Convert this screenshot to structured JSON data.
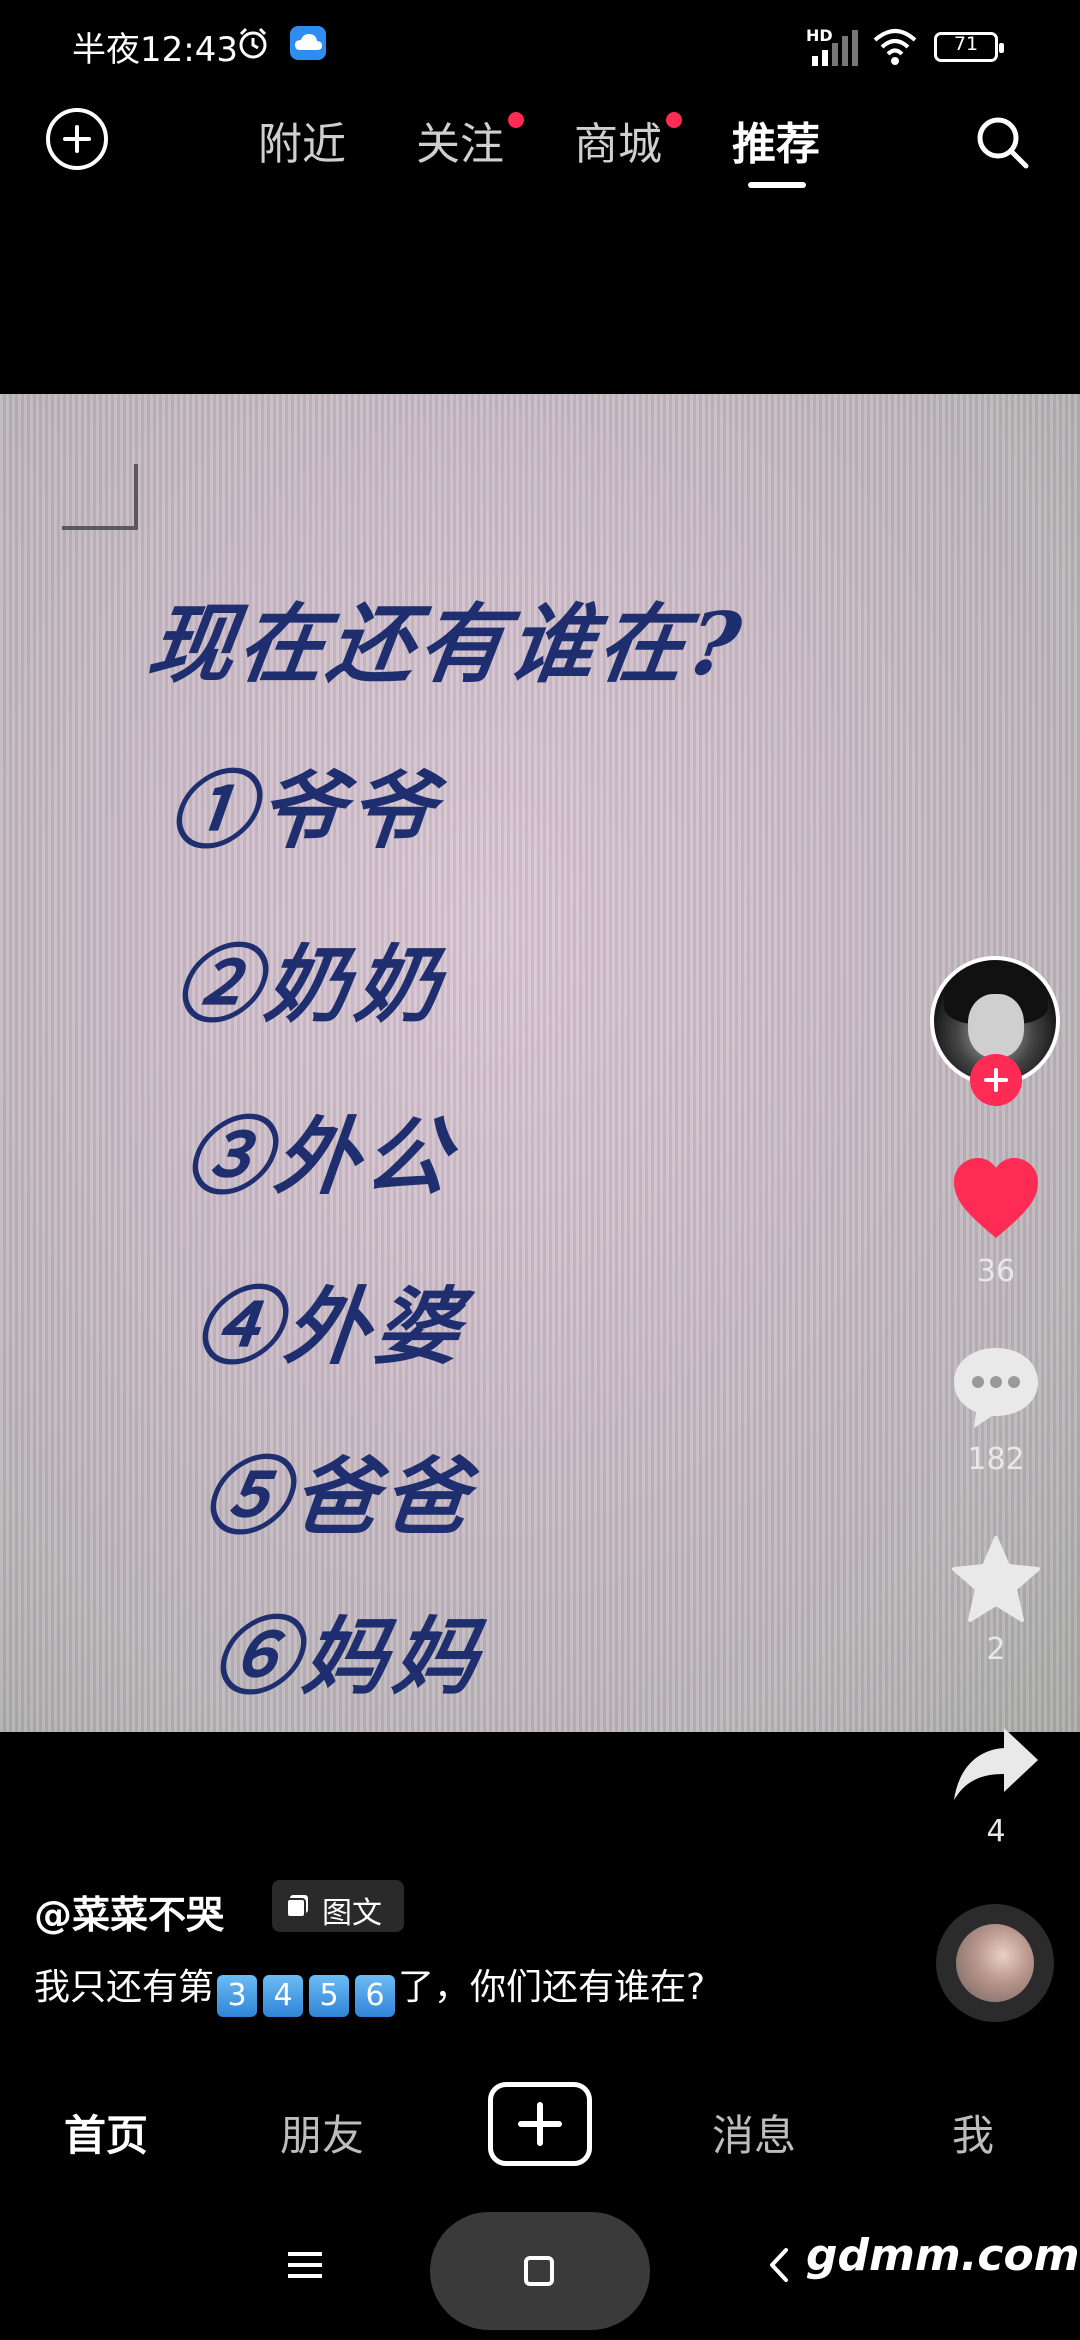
{
  "status_bar": {
    "time": "半夜12:43",
    "network_label": "HD",
    "battery": "71",
    "icons": [
      "alarm-icon",
      "cloud-app-icon",
      "signal-icon",
      "wifi-icon",
      "battery-icon"
    ]
  },
  "top_nav": {
    "tabs": [
      {
        "label": "附近",
        "has_dot": false,
        "active": false
      },
      {
        "label": "关注",
        "has_dot": true,
        "active": false
      },
      {
        "label": "商城",
        "has_dot": true,
        "active": false
      },
      {
        "label": "推荐",
        "has_dot": false,
        "active": true
      }
    ],
    "left_icon": "plus-circle-icon",
    "right_icon": "search-icon"
  },
  "post": {
    "image_text": {
      "headline": "现在还有谁在?",
      "items": [
        "①爷爷",
        "②奶奶",
        "③外公",
        "④外婆",
        "⑤爸爸",
        "⑥妈妈"
      ]
    },
    "author": "@菜菜不哭",
    "badge_label": "图文",
    "caption_prefix": "我只还有第",
    "caption_numbers": [
      "3",
      "4",
      "5",
      "6"
    ],
    "caption_suffix": "了，你们还有谁在?"
  },
  "right_rail": {
    "likes": "36",
    "comments": "182",
    "favorites": "2",
    "shares": "4"
  },
  "bottom_nav": {
    "tabs": [
      "首页",
      "朋友",
      "消息",
      "我"
    ],
    "active": "首页"
  },
  "system": {
    "watermark": "gdmm.com"
  },
  "colors": {
    "accent": "#fe2c55",
    "background": "#000000",
    "ink": "#1f2e6e"
  }
}
